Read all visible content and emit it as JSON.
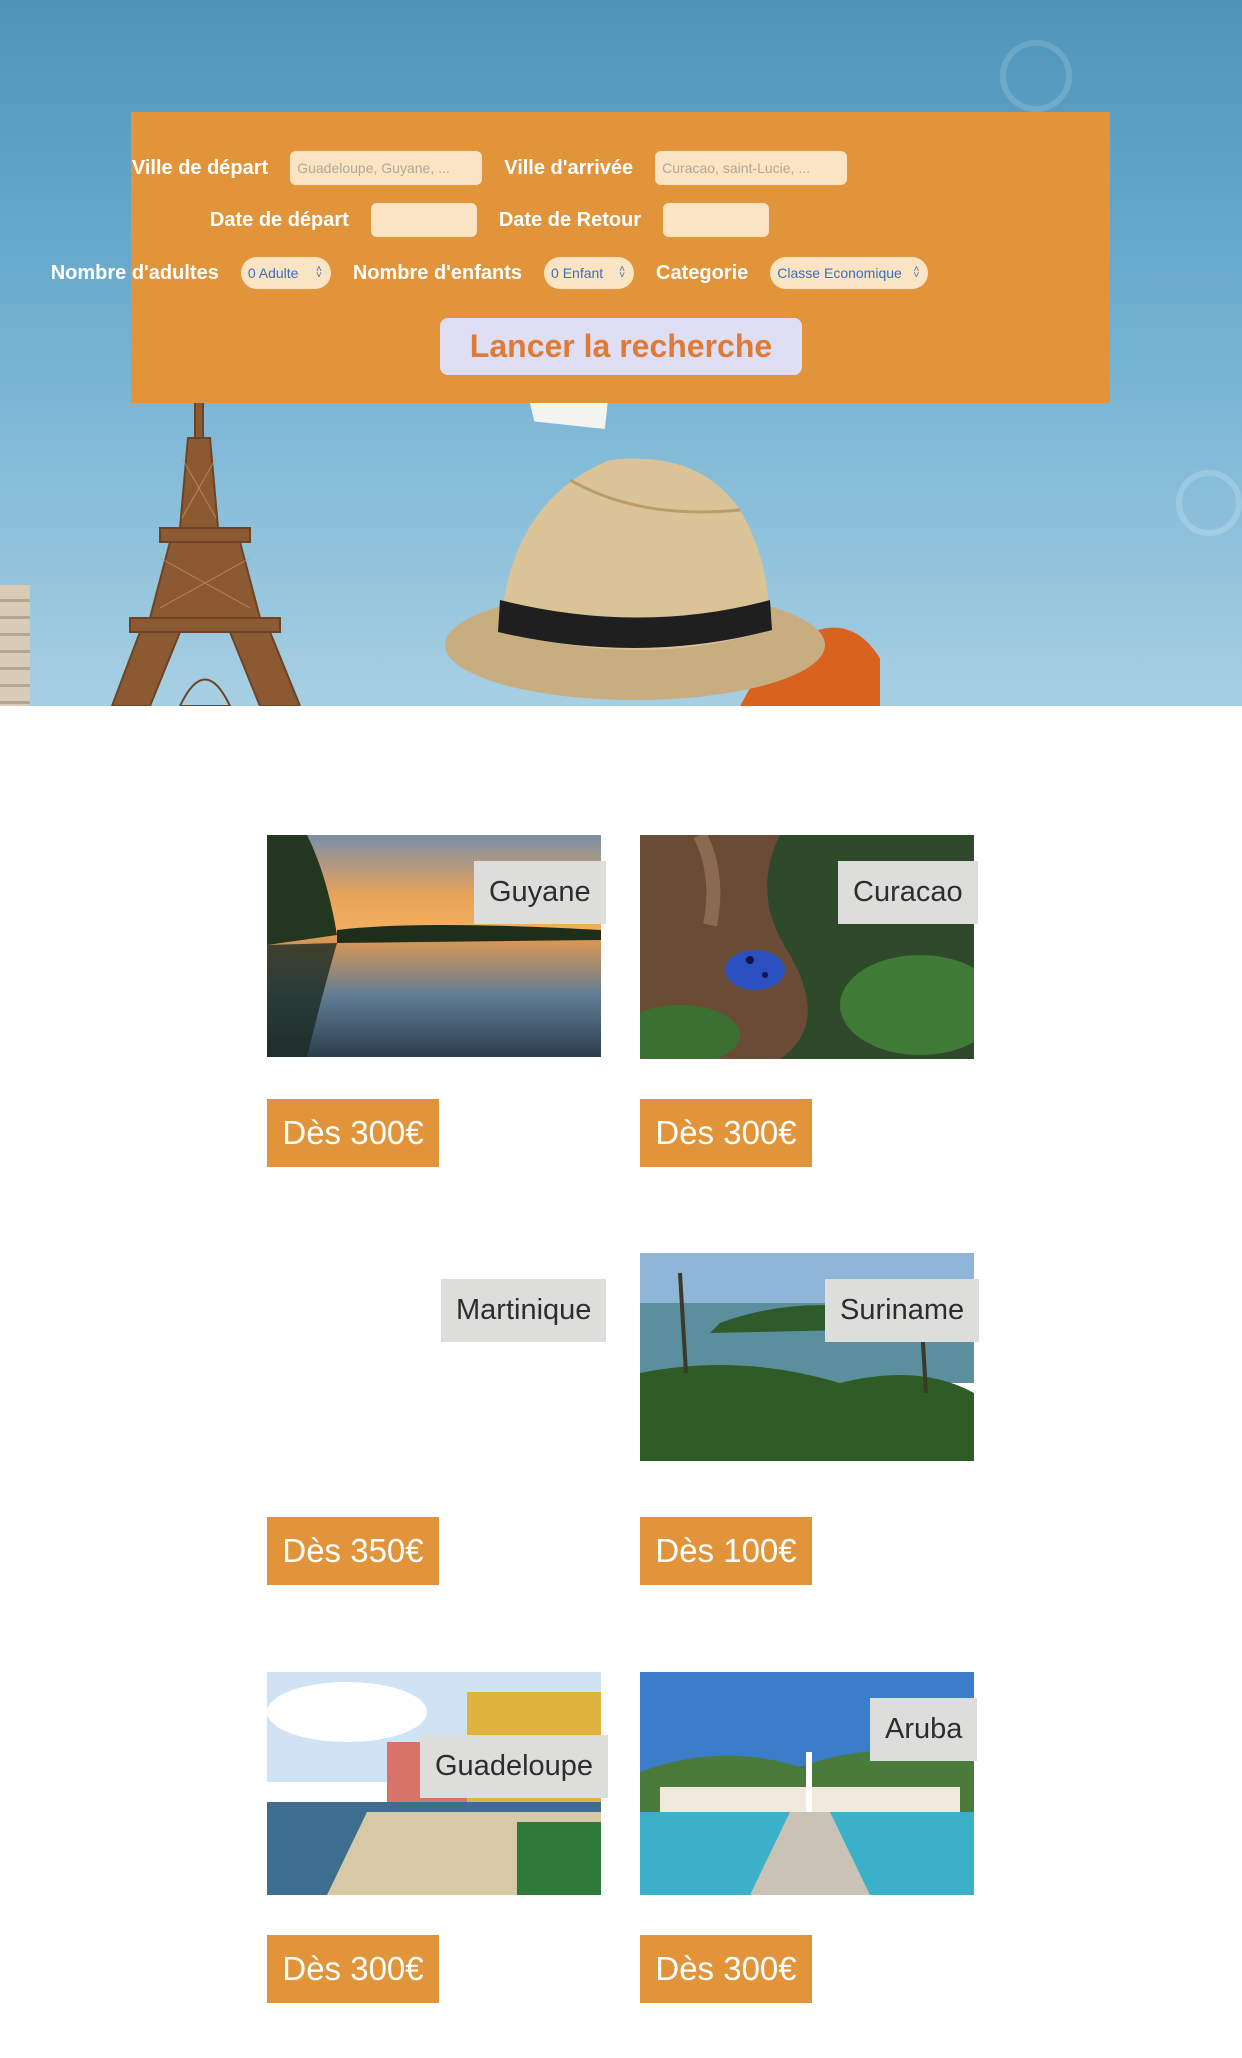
{
  "search": {
    "departure_city_label": "Ville de départ",
    "departure_city_placeholder": "Guadeloupe, Guyane, ...",
    "arrival_city_label": "Ville d'arrivée",
    "arrival_city_placeholder": "Curacao, saint-Lucie, ...",
    "departure_date_label": "Date de départ",
    "return_date_label": "Date de Retour",
    "adults_label": "Nombre d'adultes",
    "adults_value": "0 Adulte",
    "children_label": "Nombre d'enfants",
    "children_value": "0 Enfant",
    "category_label": "Categorie",
    "category_value": "Classe Economique",
    "submit_label": "Lancer la recherche"
  },
  "destinations": [
    {
      "name": "Guyane",
      "price": "Dès 300€"
    },
    {
      "name": "Curacao",
      "price": "Dès 300€"
    },
    {
      "name": "Martinique",
      "price": "Dès 350€"
    },
    {
      "name": "Suriname",
      "price": "Dès 100€"
    },
    {
      "name": "Guadeloupe",
      "price": "Dès 300€"
    },
    {
      "name": "Aruba",
      "price": "Dès 300€"
    }
  ],
  "colors": {
    "accent_orange": "#e1943a",
    "input_bg": "#fbe4c3",
    "button_bg": "#dedff5",
    "button_text": "#e07b37",
    "label_bg": "#dddddc"
  }
}
